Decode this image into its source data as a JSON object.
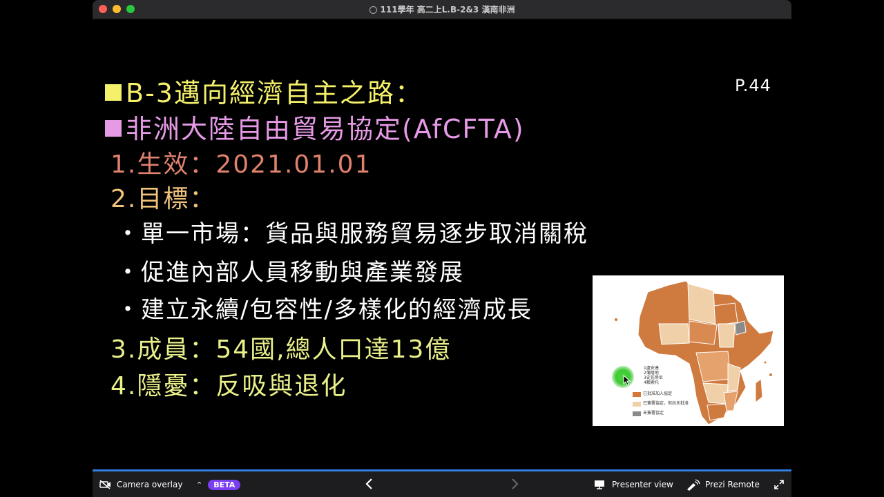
{
  "window": {
    "title": "111學年 高二上L.B-2&3 漢南非洲"
  },
  "slide": {
    "page_number": "P.44",
    "heading1": "B-3邁向經濟自主之路：",
    "heading2": "非洲大陸自由貿易協定(AfCFTA)",
    "item1": "1.生效：2021.01.01",
    "item2": "2.目標：",
    "bullet1": "・單一市場：貨品與服務貿易逐步取消關稅",
    "bullet2": "・促進內部人員移動與產業發展",
    "bullet3": "・建立永續/包容性/多樣化的經濟成長",
    "item3": "3.成員：54國,總人口達13億",
    "item4": "4.隱憂：反吸與退化",
    "colors": {
      "heading1": "#f4f06a",
      "heading2": "#e69ae6",
      "item1": "#e0826e",
      "item2": "#f0c27a",
      "bullets": "#ffffff",
      "items34": "#eaf08a"
    },
    "map": {
      "legend_numbers": [
        "1盧安達",
        "2蒲隆地",
        "3史瓦帝尼",
        "4賴索托"
      ],
      "legend": [
        {
          "label": "已批准加入協定",
          "color": "#d4783a"
        },
        {
          "label": "已簽署協定，但尚未批准",
          "color": "#f0d0a8"
        },
        {
          "label": "未簽署協定",
          "color": "#8a8a8a"
        }
      ]
    }
  },
  "toolbar": {
    "camera_label": "Camera overlay",
    "beta_label": "BETA",
    "presenter_label": "Presenter view",
    "remote_label": "Prezi Remote"
  }
}
